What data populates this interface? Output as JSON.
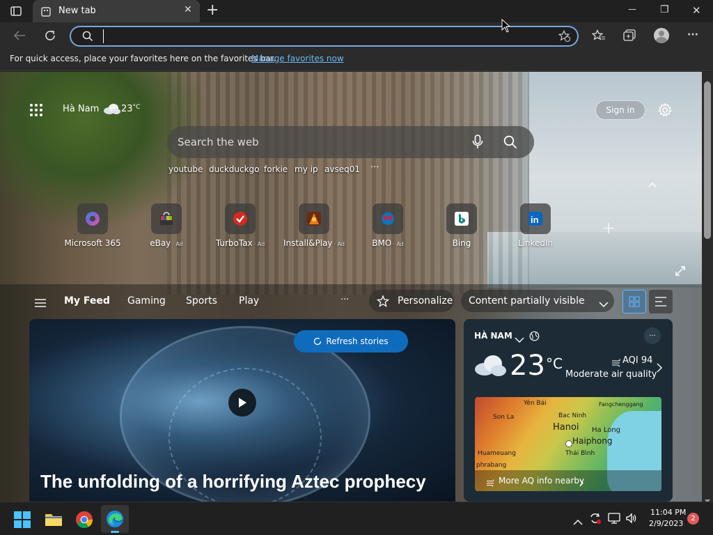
{
  "browser": {
    "tab_title": "New tab",
    "tab_close": "✕",
    "new_tab": "+",
    "minimize": "—",
    "restore": "❐",
    "close": "✕",
    "address_value": "",
    "favbar_text": "For quick access, place your favorites here on the favorites bar.",
    "favbar_link": "Manage favorites now"
  },
  "newtab": {
    "location": "Hà Nam",
    "temp": "23",
    "temp_unit": "°C",
    "sign_in": "Sign in",
    "search_placeholder": "Search the web",
    "suggestions": [
      "youtube",
      "duckduckgo",
      "forkie",
      "my ip",
      "avseq01"
    ],
    "more": "···",
    "quicklinks": [
      {
        "label": "Microsoft 365",
        "ad": ""
      },
      {
        "label": "eBay",
        "ad": "· Ad"
      },
      {
        "label": "TurboTax",
        "ad": "· Ad"
      },
      {
        "label": "Install&Play",
        "ad": "· Ad"
      },
      {
        "label": "BMO",
        "ad": "· Ad"
      },
      {
        "label": "Bing",
        "ad": ""
      },
      {
        "label": "LinkedIn",
        "ad": ""
      }
    ],
    "add_site": "+"
  },
  "feed": {
    "tabs": [
      "My Feed",
      "Gaming",
      "Sports",
      "Play"
    ],
    "more": "···",
    "personalize": "Personalize",
    "visibility": "Content partially visible",
    "refresh": "Refresh stories",
    "headline": "The unfolding of a horrifying Aztec prophecy"
  },
  "weather": {
    "location": "HÀ NAM",
    "more": "···",
    "temp": "23",
    "unit": "°C",
    "aqi": "AQI 94",
    "aqi_desc": "Moderate air quality",
    "map_labels": [
      "Yên Bái",
      "Fangchenggang",
      "Son La",
      "Bac Ninh",
      "Hanoi",
      "Ha Long",
      "Haiphong",
      "Huameuang",
      "Thái Bình",
      "phrabang"
    ],
    "more_aq": "More AQ info nearby"
  },
  "taskbar": {
    "time": "11:04 PM",
    "date": "2/9/2023",
    "notifications": "2"
  },
  "colors": {
    "accent": "#0f6cbd",
    "link": "#6cb8f6"
  }
}
